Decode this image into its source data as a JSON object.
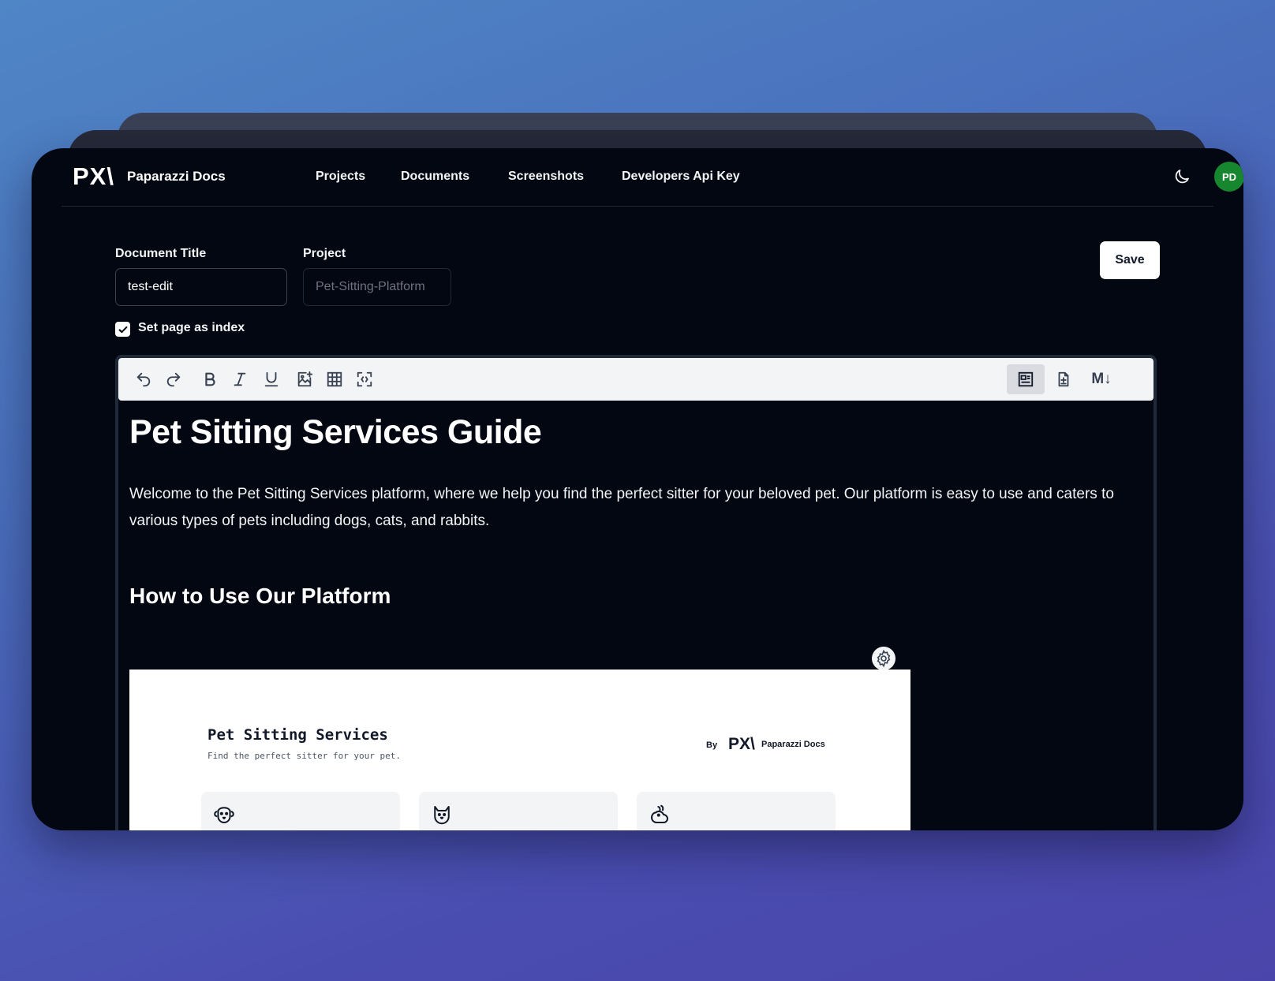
{
  "app": {
    "logo_mark": "PX\\",
    "brand": "Paparazzi Docs"
  },
  "nav": {
    "links": [
      "Projects",
      "Documents",
      "Screenshots",
      "Developers Api Key"
    ],
    "avatar_initials": "PD",
    "avatar_color": "#16862f"
  },
  "form": {
    "title_label": "Document Title",
    "title_value": "test-edit",
    "project_label": "Project",
    "project_value": "Pet-Sitting-Platform",
    "index_checkbox_label": "Set page as index",
    "index_checked": true,
    "save_label": "Save"
  },
  "toolbar": {
    "left_icons": [
      "undo-icon",
      "redo-icon",
      "bold-icon",
      "italic-icon",
      "underline-icon",
      "insert-image-icon",
      "table-icon",
      "screenshot-capture-icon"
    ],
    "right_icons": [
      "visual-editor-icon",
      "document-icon",
      "markdown-icon"
    ],
    "markdown_label": "M↓"
  },
  "document": {
    "h1": "Pet Sitting Services Guide",
    "paragraph": "Welcome to the Pet Sitting Services platform, where we help you find the perfect sitter for your beloved pet. Our platform is easy to use and caters to various types of pets including dogs, cats, and rabbits.",
    "h2": "How to Use Our Platform"
  },
  "embedded_screenshot": {
    "title": "Pet Sitting Services",
    "subtitle": "Find the perfect sitter for your pet.",
    "by_label": "By",
    "logo_mark": "PX\\",
    "brand": "Paparazzi Docs",
    "cards": [
      "dog-icon",
      "cat-icon",
      "rabbit-icon"
    ]
  },
  "colors": {
    "background": "#030712",
    "accent_white": "#ffffff",
    "toolbar_bg": "#f3f4f6"
  }
}
